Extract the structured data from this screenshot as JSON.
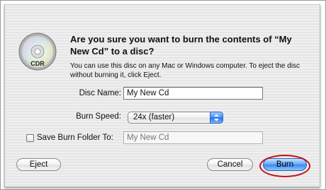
{
  "dialog": {
    "title": "Are you sure you want to burn the contents of “My New Cd” to a disc?",
    "info": "You can use this disc on any Mac or Windows computer. To eject the disc without burning it, click Eject.",
    "icon": {
      "name": "cd-icon",
      "label": "CDR"
    }
  },
  "form": {
    "disc_name_label": "Disc Name:",
    "disc_name_value": "My New Cd",
    "burn_speed_label": "Burn Speed:",
    "burn_speed_value": "24x (faster)",
    "save_folder_label": "Save Burn Folder To:",
    "save_folder_checked": false,
    "save_folder_placeholder": "My New Cd"
  },
  "buttons": {
    "eject": "Eject",
    "cancel": "Cancel",
    "burn": "Burn"
  },
  "colors": {
    "annotation_ring": "#c0111a",
    "default_button": "#3a87ef"
  }
}
